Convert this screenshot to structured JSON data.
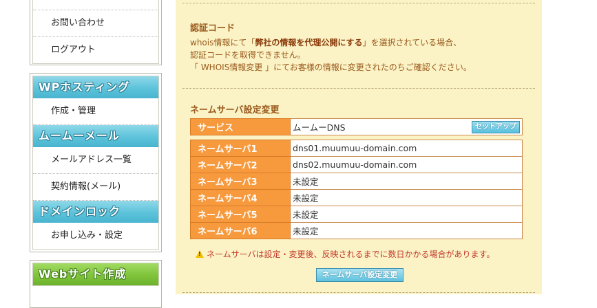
{
  "sidebar": {
    "top_items": [
      {
        "label": "お問い合わせ"
      },
      {
        "label": "ログアウト"
      }
    ],
    "wp_hosting": {
      "title": "WPホスティング",
      "items": [
        {
          "label": "作成・管理"
        }
      ]
    },
    "muumuu_mail": {
      "title": "ムームーメール",
      "items": [
        {
          "label": "メールアドレス一覧"
        },
        {
          "label": "契約情報(メール)"
        }
      ]
    },
    "domain_lock": {
      "title": "ドメインロック",
      "items": [
        {
          "label": "お申し込み・設定"
        }
      ]
    },
    "web_site": {
      "title": "Webサイト作成"
    }
  },
  "auth_code": {
    "title": "認証コード",
    "line1_prefix": "whois情報にて「",
    "line1_bold": "弊社の情報を代理公開にする",
    "line1_suffix": "」を選択されている場合、",
    "line2": "認証コードを取得できません。",
    "line3": "「 WHOIS情報変更 」にてお客様の情報に変更されたのちご確認ください。"
  },
  "nameserver": {
    "title": "ネームサーバ設定変更",
    "service_label": "サービス",
    "service_value": "ムームーDNS",
    "setup_button": "セットアップ",
    "rows": [
      {
        "label": "ネームサーバ1",
        "value": "dns01.muumuu-domain.com"
      },
      {
        "label": "ネームサーバ2",
        "value": "dns02.muumuu-domain.com"
      },
      {
        "label": "ネームサーバ3",
        "value": "未設定"
      },
      {
        "label": "ネームサーバ4",
        "value": "未設定"
      },
      {
        "label": "ネームサーバ5",
        "value": "未設定"
      },
      {
        "label": "ネームサーバ6",
        "value": "未設定"
      }
    ],
    "warning": "ネームサーバは設定・変更後、反映されるまでに数日かかる場合があります。",
    "submit_button": "ネームサーバ設定変更"
  }
}
